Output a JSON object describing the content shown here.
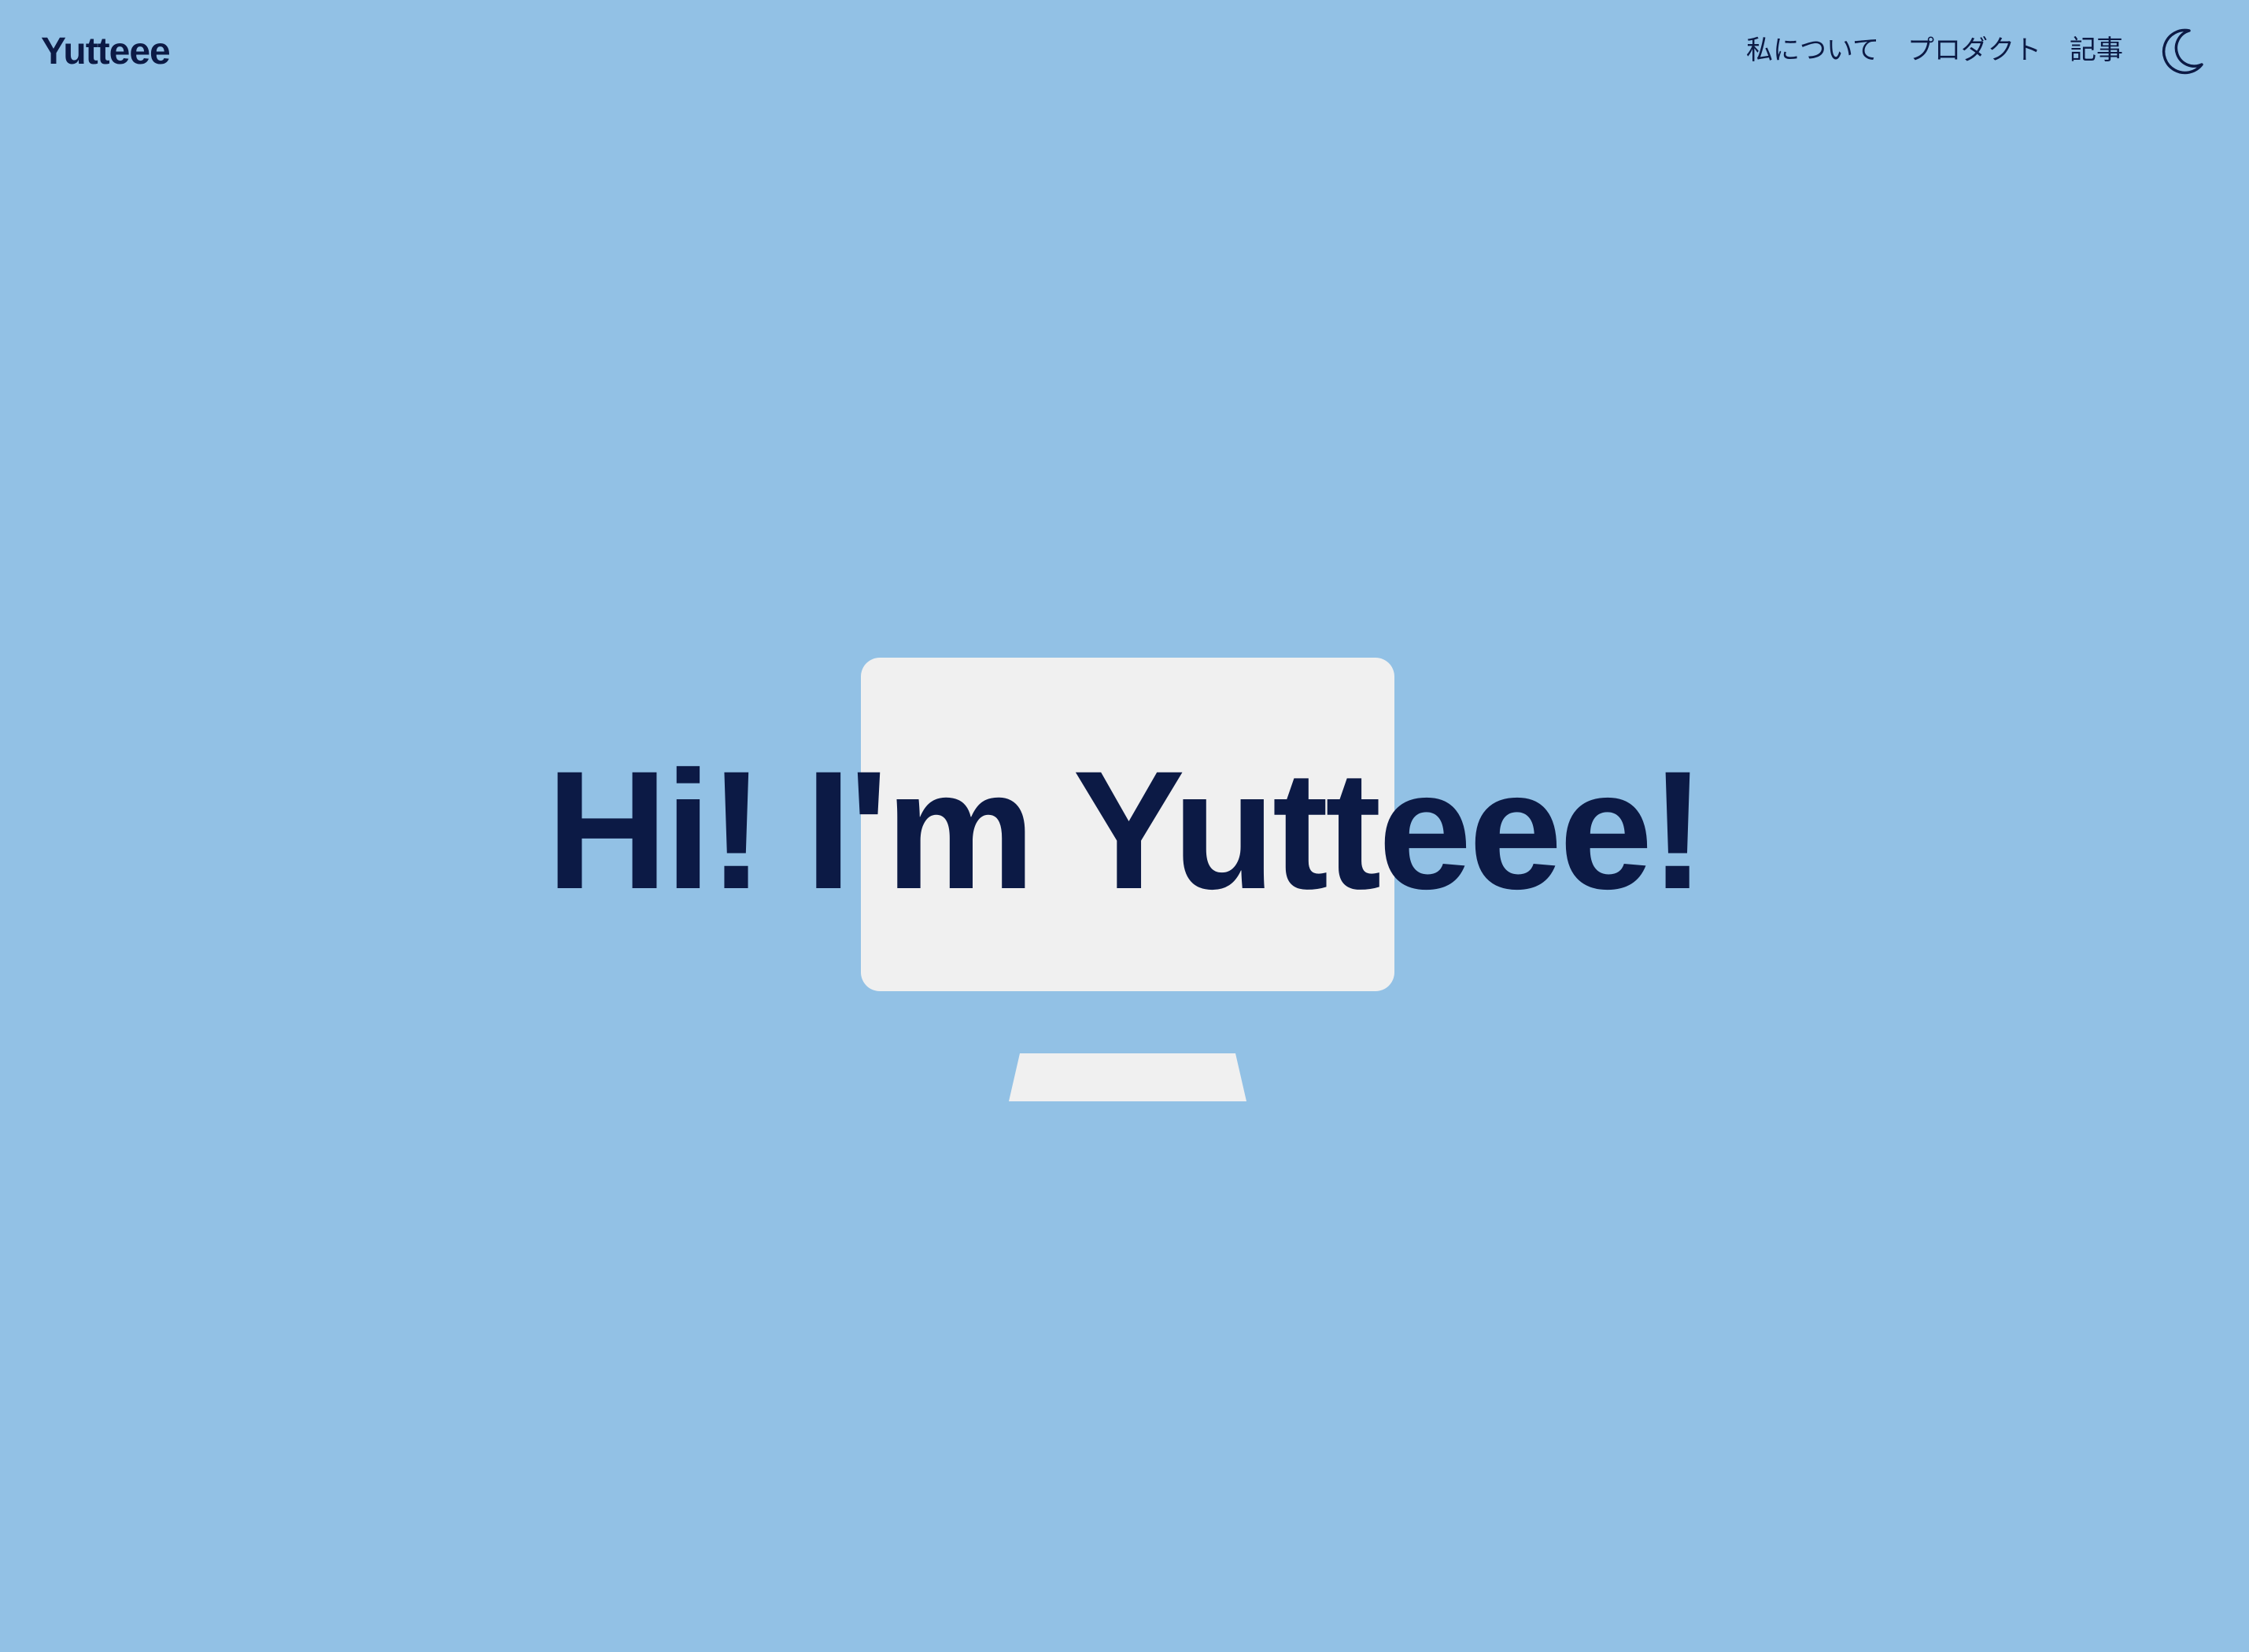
{
  "header": {
    "logo": "Yutteee",
    "nav": [
      {
        "label": "私について"
      },
      {
        "label": "プロダクト"
      },
      {
        "label": "記事"
      }
    ],
    "theme_toggle_icon": "moon-icon"
  },
  "hero": {
    "title": "Hi! I'm Yutteee!",
    "illustration": "monitor-icon"
  },
  "colors": {
    "background": "#92c1e5",
    "text": "#0c1a45",
    "monitor": "#f0f0f0"
  }
}
